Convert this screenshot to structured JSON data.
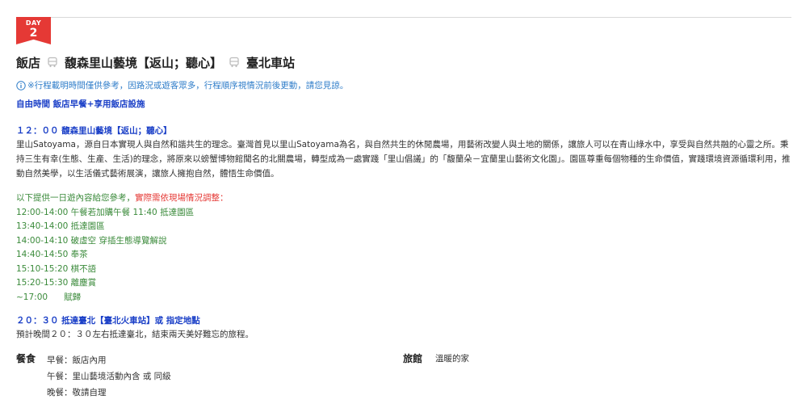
{
  "day": {
    "label": "DAY",
    "number": "2"
  },
  "route": {
    "items": [
      "飯店",
      "馥森里山藝境【返山；聽心】",
      "臺北車站"
    ]
  },
  "notice": "※行程載明時間僅供參考，因路況或遊客眾多，行程順序視情況前後更動，請您見諒。",
  "free_time": "自由時間 飯店早餐+享用飯店設施",
  "stop1": {
    "title": "１２：００ 馥森里山藝境【返山；聽心】",
    "description": "里山Satoyama，源自日本實現人與自然和諧共生的理念。臺灣首見以里山Satoyama為名，與自然共生的休閒農場，用藝術改變人與土地的關係，讓旅人可以在青山綠水中，享受與自然共融的心靈之所。秉持三生有幸(生態、生產、生活)的理念，將原來以螃蟹博物館聞名的北關農場，轉型成為一處實踐「里山倡議」的「馥蘭朵－宜蘭里山藝術文化園」。園區尊重每個物種的生命價值，實踐環境資源循環利用，推動自然美學，以生活儀式藝術展演，讓旅人擁抱自然，體悟生命價值。"
  },
  "schedule": {
    "intro": "以下提供一日遊內容給您參考，",
    "warning": "實際需依現場情況調整：",
    "items": [
      "12:00-14:00 午餐若加購午餐 11:40 抵達園區",
      "13:40-14:00 抵達園區",
      "14:00-14:10 破虛空 穿插生態導覽解說",
      "14:40-14:50 奉茶",
      "15:10-15:20 棋不語",
      "15:20-15:30 離塵賞",
      "~17:00      賦歸"
    ]
  },
  "stop2": {
    "title": "２０：３０ 抵達臺北【臺北火車站】或 指定地點",
    "description": "預計晚間２０：３０左右抵達臺北，結束兩天美好難忘的旅程。"
  },
  "meals": {
    "heading": "餐食",
    "items": [
      "早餐：飯店內用",
      "午餐：里山藝境活動內含 或 同級",
      "晚餐：敬請自理"
    ]
  },
  "hotel": {
    "heading": "旅館",
    "value": "溫暖的家"
  },
  "colors": {
    "accent": "#e53935",
    "link_blue": "#1a3fc7",
    "info_blue": "#2f7dc9",
    "schedule_green": "#3a8a3a"
  }
}
